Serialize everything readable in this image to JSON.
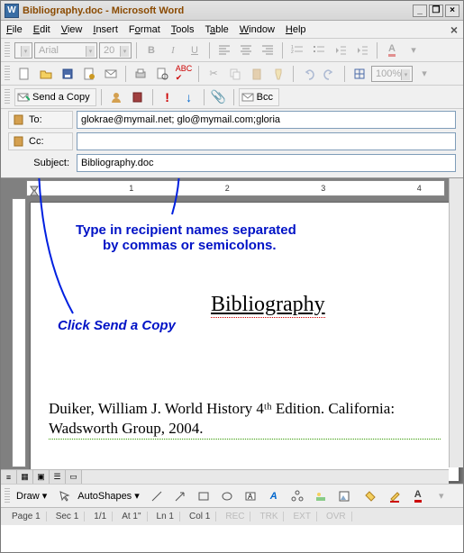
{
  "window": {
    "title": "Bibliography.doc - Microsoft Word",
    "app_icon_letter": "W"
  },
  "menu": [
    "File",
    "Edit",
    "View",
    "Insert",
    "Format",
    "Tools",
    "Table",
    "Window",
    "Help"
  ],
  "format_toolbar": {
    "style_placeholder": "",
    "font": "Arial",
    "size": "20",
    "bold": "B",
    "italic": "I",
    "underline": "U"
  },
  "standard_toolbar": {
    "zoom": "100%"
  },
  "mail_toolbar": {
    "send_label": "Send a Copy",
    "bcc_label": "Bcc"
  },
  "fields": {
    "to_label": "To:",
    "to_value": "glokrae@mymail.net; glo@mymail.com;gloria",
    "cc_label": "Cc:",
    "cc_value": "",
    "subject_label": "Subject:",
    "subject_value": "Bibliography.doc"
  },
  "ruler_numbers": [
    "1",
    "2",
    "3",
    "4"
  ],
  "annotations": {
    "type_recipients_l1": "Type in recipient names separated",
    "type_recipients_l2": "by commas or semicolons.",
    "click_send": "Click Send a Copy"
  },
  "document": {
    "title": "Bibliography",
    "entry": "Duiker, William J. World History 4ᵗʰ Edition. California: Wadsworth Group, 2004."
  },
  "draw_toolbar": {
    "draw_label": "Draw",
    "autoshapes_label": "AutoShapes"
  },
  "status": {
    "page": "Page 1",
    "sec": "Sec 1",
    "pages": "1/1",
    "at": "At 1\"",
    "ln": "Ln 1",
    "col": "Col 1",
    "modes": [
      "REC",
      "TRK",
      "EXT",
      "OVR"
    ]
  }
}
